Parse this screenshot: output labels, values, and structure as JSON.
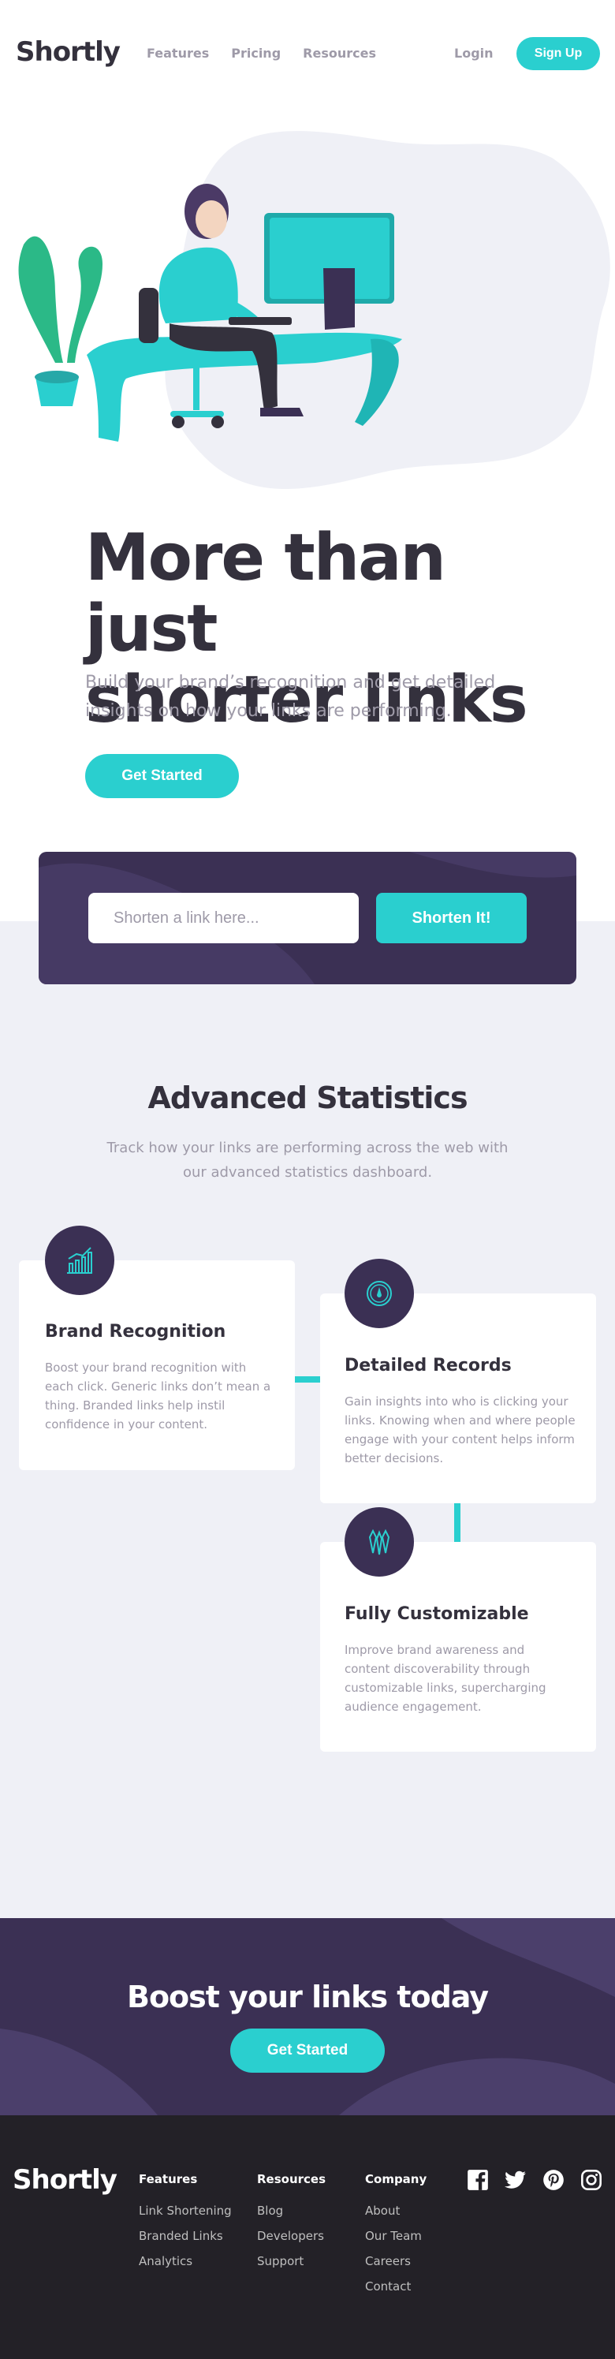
{
  "brand": {
    "logo": "Shortly"
  },
  "header": {
    "nav": [
      "Features",
      "Pricing",
      "Resources"
    ],
    "login": "Login",
    "signup": "Sign Up"
  },
  "hero": {
    "title_line1": "More than just",
    "title_line2": "shorter links",
    "subtitle": "Build your brand’s recognition and get detailed insights on how your links are performing.",
    "cta": "Get Started"
  },
  "shorten": {
    "placeholder": "Shorten a link here...",
    "button": "Shorten It!"
  },
  "stats": {
    "title": "Advanced Statistics",
    "subtitle": "Track how your links are performing across the web with our advanced statistics dashboard.",
    "cards": [
      {
        "icon": "chart-icon",
        "title": "Brand Recognition",
        "text": "Boost your brand recognition with each click. Generic links don’t mean a thing. Branded links help instil confidence in your content."
      },
      {
        "icon": "gauge-icon",
        "title": "Detailed Records",
        "text": "Gain insights into who is clicking your links. Knowing when and where people engage with your content helps inform better decisions."
      },
      {
        "icon": "pens-icon",
        "title": "Fully Customizable",
        "text": "Improve brand awareness and content discoverability through customizable links, supercharging audience engagement."
      }
    ]
  },
  "boost": {
    "title": "Boost your links today",
    "cta": "Get Started"
  },
  "footer": {
    "logo": "Shortly",
    "columns": [
      {
        "heading": "Features",
        "links": [
          "Link Shortening",
          "Branded Links",
          "Analytics"
        ]
      },
      {
        "heading": "Resources",
        "links": [
          "Blog",
          "Developers",
          "Support"
        ]
      },
      {
        "heading": "Company",
        "links": [
          "About",
          "Our Team",
          "Careers",
          "Contact"
        ]
      }
    ],
    "social": [
      "facebook-icon",
      "twitter-icon",
      "pinterest-icon",
      "instagram-icon"
    ]
  },
  "colors": {
    "cyan": "#2acfcf",
    "violet": "#3b3054",
    "dark": "#34313d",
    "grey": "#9e9aa8",
    "light": "#eff0f6",
    "footer": "#232127"
  }
}
